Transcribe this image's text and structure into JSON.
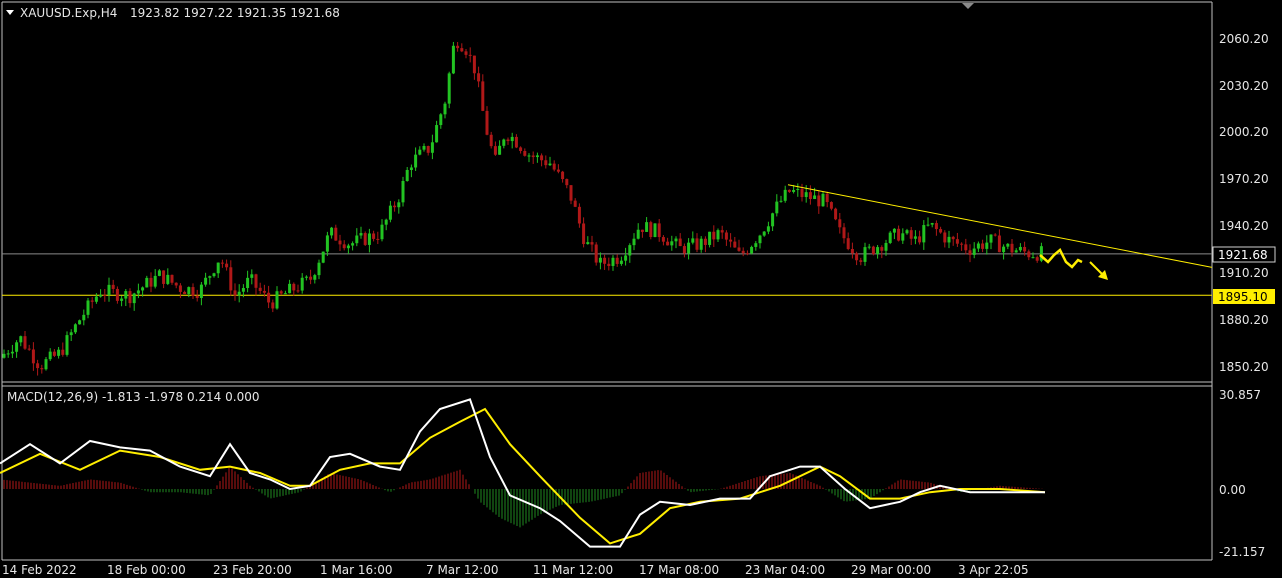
{
  "header": {
    "menu_icon": "triangle-down-icon",
    "symbol": "XAUUSD.Exp,H4",
    "ohlc": "1923.82 1927.22 1921.35 1921.68"
  },
  "macd_panel": {
    "label": "MACD(12,26,9) -1.813 -1.978 0.214 0.000",
    "scale_top": "30.857",
    "scale_mid": "0.00",
    "scale_bottom": "-21.157"
  },
  "price_scale": [
    "2060.20",
    "2030.20",
    "2000.20",
    "1970.20",
    "1940.20",
    "1910.20",
    "1880.20",
    "1850.20"
  ],
  "markers": {
    "current_price": "1921.68",
    "support_level": "1895.10"
  },
  "time_axis": [
    "14 Feb 2022",
    "18 Feb 00:00",
    "23 Feb 20:00",
    "1 Mar 16:00",
    "7 Mar 12:00",
    "11 Mar 12:00",
    "17 Mar 08:00",
    "23 Mar 04:00",
    "29 Mar 00:00",
    "3 Apr 22:05"
  ],
  "colors": {
    "bull": "#22c322",
    "bear": "#b01818",
    "macd_line": "#ffffff",
    "signal_line": "#ffee00",
    "trendline": "#ffee00",
    "current_price_line": "#8a8a8a",
    "support_box": "#ffee00",
    "background": "#000000"
  },
  "chart_data": {
    "type": "candlestick",
    "price_range": [
      1840,
      2072
    ],
    "path": [
      [
        0,
        1855
      ],
      [
        20,
        1868
      ],
      [
        40,
        1850
      ],
      [
        60,
        1858
      ],
      [
        80,
        1880
      ],
      [
        100,
        1898
      ],
      [
        130,
        1895
      ],
      [
        160,
        1908
      ],
      [
        180,
        1900
      ],
      [
        200,
        1898
      ],
      [
        220,
        1920
      ],
      [
        235,
        1895
      ],
      [
        250,
        1905
      ],
      [
        270,
        1890
      ],
      [
        290,
        1898
      ],
      [
        310,
        1905
      ],
      [
        330,
        1935
      ],
      [
        350,
        1928
      ],
      [
        380,
        1935
      ],
      [
        400,
        1960
      ],
      [
        410,
        1980
      ],
      [
        430,
        1990
      ],
      [
        445,
        2020
      ],
      [
        455,
        2060
      ],
      [
        465,
        2055
      ],
      [
        475,
        2040
      ],
      [
        485,
        2005
      ],
      [
        495,
        1980
      ],
      [
        505,
        2000
      ],
      [
        515,
        1995
      ],
      [
        530,
        1985
      ],
      [
        550,
        1980
      ],
      [
        570,
        1960
      ],
      [
        585,
        1930
      ],
      [
        600,
        1915
      ],
      [
        620,
        1920
      ],
      [
        640,
        1940
      ],
      [
        660,
        1935
      ],
      [
        680,
        1925
      ],
      [
        700,
        1928
      ],
      [
        720,
        1935
      ],
      [
        740,
        1920
      ],
      [
        760,
        1935
      ],
      [
        780,
        1955
      ],
      [
        790,
        1962
      ],
      [
        810,
        1958
      ],
      [
        825,
        1955
      ],
      [
        840,
        1935
      ],
      [
        860,
        1920
      ],
      [
        880,
        1928
      ],
      [
        900,
        1935
      ],
      [
        915,
        1930
      ],
      [
        930,
        1940
      ],
      [
        950,
        1930
      ],
      [
        970,
        1925
      ],
      [
        990,
        1930
      ],
      [
        1010,
        1925
      ],
      [
        1030,
        1922
      ],
      [
        1045,
        1922
      ]
    ],
    "trendline": {
      "from": [
        788,
        1966
      ],
      "to": [
        1212,
        1913
      ]
    },
    "horizontal_lines": [
      1921.68,
      1895.1
    ],
    "macd_range": [
      -21.157,
      30.857
    ],
    "macd": [
      [
        0,
        8
      ],
      [
        30,
        14
      ],
      [
        60,
        8
      ],
      [
        90,
        15
      ],
      [
        120,
        13
      ],
      [
        150,
        12
      ],
      [
        180,
        7
      ],
      [
        210,
        4
      ],
      [
        230,
        14
      ],
      [
        250,
        5
      ],
      [
        270,
        3
      ],
      [
        290,
        0
      ],
      [
        310,
        1
      ],
      [
        330,
        10
      ],
      [
        350,
        11
      ],
      [
        380,
        7
      ],
      [
        400,
        6
      ],
      [
        420,
        18
      ],
      [
        440,
        25
      ],
      [
        470,
        28
      ],
      [
        490,
        10
      ],
      [
        510,
        -2
      ],
      [
        540,
        -6
      ],
      [
        560,
        -10
      ],
      [
        590,
        -18
      ],
      [
        620,
        -18
      ],
      [
        640,
        -8
      ],
      [
        660,
        -4
      ],
      [
        690,
        -5
      ],
      [
        720,
        -3
      ],
      [
        750,
        -3
      ],
      [
        770,
        4
      ],
      [
        800,
        7
      ],
      [
        820,
        7
      ],
      [
        845,
        0
      ],
      [
        870,
        -6
      ],
      [
        900,
        -4
      ],
      [
        920,
        -1
      ],
      [
        940,
        1
      ],
      [
        970,
        -1
      ],
      [
        1000,
        -1
      ],
      [
        1030,
        -1
      ],
      [
        1045,
        -1
      ]
    ],
    "signal": [
      [
        0,
        5
      ],
      [
        40,
        11
      ],
      [
        80,
        6
      ],
      [
        120,
        12
      ],
      [
        160,
        10
      ],
      [
        200,
        6
      ],
      [
        230,
        7
      ],
      [
        260,
        5
      ],
      [
        290,
        1
      ],
      [
        310,
        1
      ],
      [
        340,
        6
      ],
      [
        370,
        8
      ],
      [
        400,
        8
      ],
      [
        430,
        16
      ],
      [
        460,
        21
      ],
      [
        485,
        25
      ],
      [
        510,
        14
      ],
      [
        540,
        4
      ],
      [
        580,
        -9
      ],
      [
        610,
        -17
      ],
      [
        640,
        -14
      ],
      [
        670,
        -6
      ],
      [
        700,
        -4
      ],
      [
        740,
        -3
      ],
      [
        780,
        1
      ],
      [
        820,
        7
      ],
      [
        840,
        4
      ],
      [
        870,
        -3
      ],
      [
        900,
        -3
      ],
      [
        930,
        -1
      ],
      [
        960,
        0
      ],
      [
        1000,
        0
      ],
      [
        1045,
        -1
      ]
    ],
    "histogram": [
      [
        0,
        3
      ],
      [
        30,
        2
      ],
      [
        60,
        1
      ],
      [
        90,
        3
      ],
      [
        120,
        2
      ],
      [
        150,
        -1
      ],
      [
        180,
        -1
      ],
      [
        210,
        -2
      ],
      [
        230,
        7
      ],
      [
        250,
        1
      ],
      [
        270,
        -3
      ],
      [
        300,
        -1
      ],
      [
        330,
        5
      ],
      [
        360,
        3
      ],
      [
        390,
        -1
      ],
      [
        410,
        2
      ],
      [
        430,
        3
      ],
      [
        460,
        6
      ],
      [
        480,
        -4
      ],
      [
        500,
        -9
      ],
      [
        520,
        -12
      ],
      [
        540,
        -8
      ],
      [
        560,
        -5
      ],
      [
        590,
        -4
      ],
      [
        620,
        -2
      ],
      [
        640,
        5
      ],
      [
        660,
        6
      ],
      [
        690,
        -1
      ],
      [
        720,
        0
      ],
      [
        760,
        4
      ],
      [
        790,
        5
      ],
      [
        820,
        1
      ],
      [
        845,
        -4
      ],
      [
        870,
        -3
      ],
      [
        900,
        3
      ],
      [
        930,
        2
      ],
      [
        960,
        -1
      ],
      [
        1000,
        1
      ],
      [
        1045,
        0
      ]
    ]
  }
}
